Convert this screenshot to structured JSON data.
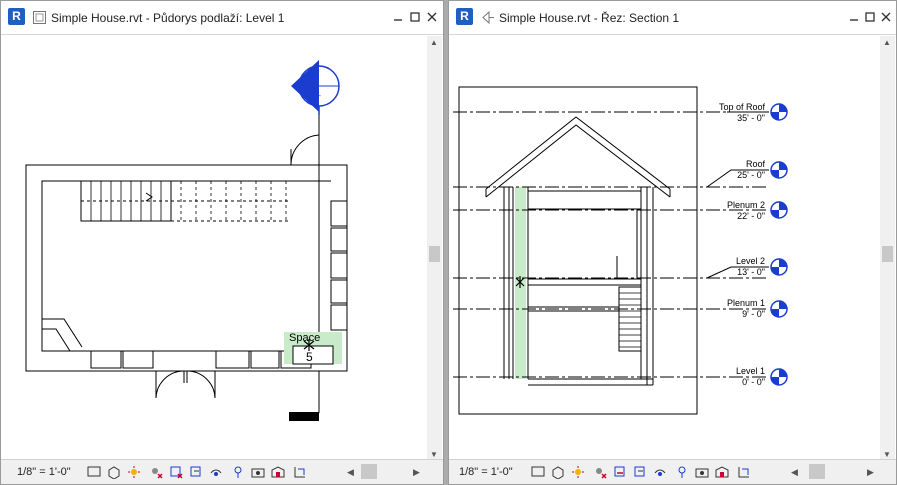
{
  "app": {
    "logo_letter": "R"
  },
  "left_window": {
    "title": "Simple House.rvt - Půdorys podlaží: Level 1",
    "scale": "1/8\" = 1'-0\"",
    "space_tag": {
      "name": "Space",
      "number": "5"
    }
  },
  "right_window": {
    "title": "Simple House.rvt - Řez: Section 1",
    "scale": "1/8\" = 1'-0\"",
    "levels": [
      {
        "name": "Top of Roof",
        "elevation": "35' - 0\""
      },
      {
        "name": "Roof",
        "elevation": "25' - 0\""
      },
      {
        "name": "Plenum 2",
        "elevation": "22' - 0\""
      },
      {
        "name": "Level 2",
        "elevation": "13' - 0\""
      },
      {
        "name": "Plenum 1",
        "elevation": "9' - 0\""
      },
      {
        "name": "Level 1",
        "elevation": "0' - 0\""
      }
    ]
  },
  "colors": {
    "accent": "#1f5fbf",
    "level_marker": "#1a3ccf",
    "space_fill": "#c9ebc9"
  }
}
